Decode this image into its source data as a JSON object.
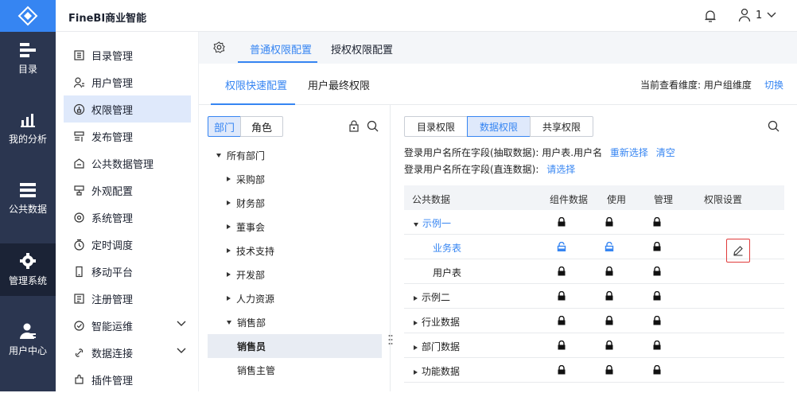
{
  "app": {
    "title": "FineBI商业智能"
  },
  "user": {
    "name": "1"
  },
  "rail": {
    "items": [
      {
        "label": "目录",
        "icon": "catalog-icon"
      },
      {
        "label": "我的分析",
        "icon": "analysis-icon"
      },
      {
        "label": "公共数据",
        "icon": "public-data-icon"
      },
      {
        "label": "管理系统",
        "icon": "gear-icon",
        "active": true
      },
      {
        "label": "用户中心",
        "icon": "user-center-icon"
      }
    ]
  },
  "nav": {
    "items": [
      {
        "label": "目录管理",
        "icon": "catalog-manage-icon"
      },
      {
        "label": "用户管理",
        "icon": "user-manage-icon"
      },
      {
        "label": "权限管理",
        "icon": "permission-icon",
        "active": true
      },
      {
        "label": "发布管理",
        "icon": "publish-icon"
      },
      {
        "label": "公共数据管理",
        "icon": "data-manage-icon"
      },
      {
        "label": "外观配置",
        "icon": "appearance-icon"
      },
      {
        "label": "系统管理",
        "icon": "system-icon"
      },
      {
        "label": "定时调度",
        "icon": "schedule-icon"
      },
      {
        "label": "移动平台",
        "icon": "mobile-icon"
      },
      {
        "label": "注册管理",
        "icon": "register-icon"
      },
      {
        "label": "智能运维",
        "icon": "ops-icon",
        "expandable": true
      },
      {
        "label": "数据连接",
        "icon": "connection-icon",
        "expandable": true
      },
      {
        "label": "插件管理",
        "icon": "plugin-icon"
      }
    ]
  },
  "tabs1": {
    "normal": "普通权限配置",
    "grant": "授权权限配置"
  },
  "tabs2": {
    "quick": "权限快速配置",
    "final": "用户最终权限"
  },
  "view": {
    "dimension": "当前查看维度: 用户组维度",
    "switch": "切换"
  },
  "tree": {
    "seg_dept": "部门",
    "seg_role": "角色",
    "rows": [
      {
        "label": "所有部门",
        "level": 0,
        "tri": "d"
      },
      {
        "label": "采购部",
        "level": 1,
        "tri": "r"
      },
      {
        "label": "财务部",
        "level": 1,
        "tri": "r"
      },
      {
        "label": "董事会",
        "level": 1,
        "tri": "r"
      },
      {
        "label": "技术支持",
        "level": 1,
        "tri": "r"
      },
      {
        "label": "开发部",
        "level": 1,
        "tri": "r"
      },
      {
        "label": "人力资源",
        "level": 1,
        "tri": "r"
      },
      {
        "label": "销售部",
        "level": 1,
        "tri": "d"
      },
      {
        "label": "销售员",
        "level": 2,
        "tri": "",
        "selected": true
      },
      {
        "label": "销售主管",
        "level": 2,
        "tri": ""
      }
    ]
  },
  "perm": {
    "tab_catalog": "目录权限",
    "tab_data": "数据权限",
    "tab_share": "共享权限",
    "line1_label": "登录用户名所在字段(抽取数据):",
    "line1_value": "用户表.用户名",
    "line1_reselect": "重新选择",
    "line1_clear": "清空",
    "line2_label": "登录用户名所在字段(直连数据):",
    "line2_select": "请选择"
  },
  "table": {
    "headers": [
      "公共数据",
      "组件数据",
      "使用",
      "管理",
      "权限设置"
    ],
    "rows": [
      {
        "name": "示例一",
        "level": 0,
        "tri": "d",
        "blue": true,
        "locks": [
          "locked",
          "locked",
          "locked"
        ],
        "edit": false
      },
      {
        "name": "业务表",
        "level": 1,
        "tri": "",
        "blue": true,
        "locks": [
          "unlocked",
          "unlocked",
          "locked"
        ],
        "edit": true
      },
      {
        "name": "用户表",
        "level": 1,
        "tri": "",
        "blue": false,
        "locks": [
          "locked",
          "locked",
          "locked"
        ],
        "edit": false
      },
      {
        "name": "示例二",
        "level": 0,
        "tri": "r",
        "blue": false,
        "locks": [
          "locked",
          "locked",
          "locked"
        ],
        "edit": false
      },
      {
        "name": "行业数据",
        "level": 0,
        "tri": "r",
        "blue": false,
        "locks": [
          "locked",
          "locked",
          "locked"
        ],
        "edit": false
      },
      {
        "name": "部门数据",
        "level": 0,
        "tri": "r",
        "blue": false,
        "locks": [
          "locked",
          "locked",
          "locked"
        ],
        "edit": false
      },
      {
        "name": "功能数据",
        "level": 0,
        "tri": "r",
        "blue": false,
        "locks": [
          "locked",
          "locked",
          "locked"
        ],
        "edit": false
      }
    ]
  },
  "colors": {
    "accent": "#3685f2",
    "rail": "#2b3650",
    "highlight": "#e03b3b"
  }
}
